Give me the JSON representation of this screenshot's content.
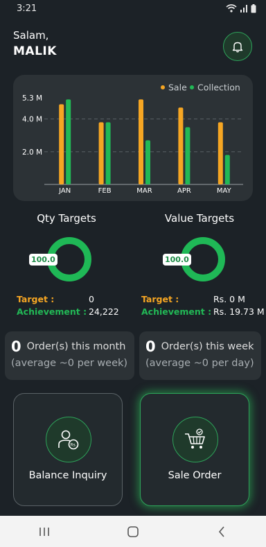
{
  "status_bar": {
    "time": "3:21",
    "icons": [
      "wifi-icon",
      "signal-icon",
      "battery-icon"
    ]
  },
  "header": {
    "greeting": "Salam,",
    "user_name": "MALIK",
    "notification_icon": "bell-icon"
  },
  "chart_data": {
    "type": "bar",
    "categories": [
      "JAN",
      "FEB",
      "MAR",
      "APR",
      "MAY"
    ],
    "series": [
      {
        "name": "Sale",
        "color": "#f6a623",
        "values": [
          4.9,
          3.8,
          5.2,
          4.7,
          3.8
        ]
      },
      {
        "name": "Collection",
        "color": "#22b856",
        "values": [
          5.2,
          3.8,
          2.7,
          3.5,
          1.8
        ]
      }
    ],
    "y_tick_labels": [
      "5.3 M",
      "4.0 M",
      "2.0 M"
    ],
    "y_tick_values": [
      5.3,
      4.0,
      2.0
    ],
    "ylim": [
      0,
      5.3
    ],
    "grid": true,
    "legend_position": "top-right"
  },
  "targets": {
    "qty": {
      "title": "Qty Targets",
      "progress_label": "100.0",
      "progress_fraction": 1.0,
      "target_label": "Target :",
      "target_value": "0",
      "achievement_label": "Achievement :",
      "achievement_value": "24,222"
    },
    "value": {
      "title": "Value Targets",
      "progress_label": "100.0",
      "progress_fraction": 1.0,
      "target_label": "Target :",
      "target_value": "Rs. 0 M",
      "achievement_label": "Achievement :",
      "achievement_value": "Rs. 19.73 M"
    }
  },
  "orders": {
    "month": {
      "count": "0",
      "text": "Order(s) this month",
      "sub": "(average ~0 per week)"
    },
    "week": {
      "count": "0",
      "text": "Order(s) this week",
      "sub": "(average ~0 per day)"
    }
  },
  "actions": {
    "balance": {
      "label": "Balance Inquiry",
      "icon": "user-balance-icon"
    },
    "sale_order": {
      "label": "Sale Order",
      "icon": "cart-icon"
    }
  },
  "nav": {
    "icons": [
      "recent-apps-icon",
      "home-icon",
      "back-icon"
    ]
  },
  "colors": {
    "accent": "#22b856",
    "sale": "#f6a623",
    "background": "#1c2227",
    "card": "#2c3236"
  }
}
